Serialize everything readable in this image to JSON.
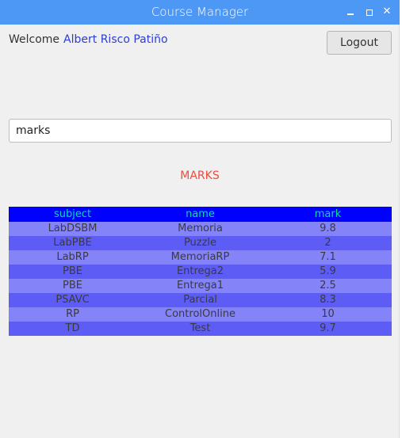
{
  "window": {
    "title": "Course Manager",
    "titlebar_color": "#4d98f5"
  },
  "header": {
    "welcome_label": "Welcome",
    "user_name": "Albert Risco Patiño",
    "logout_label": "Logout"
  },
  "search": {
    "value": "marks"
  },
  "section": {
    "title": "MARKS",
    "title_color": "#f04a3a"
  },
  "table": {
    "header_color": "#0000ff",
    "header_text_color": "#00e0a0",
    "row_color_light": "#8484f8",
    "row_color_dark": "#5d5df6",
    "columns": [
      "subject",
      "name",
      "mark"
    ],
    "rows": [
      [
        "LabDSBM",
        "Memoria",
        "9.8"
      ],
      [
        "LabPBE",
        "Puzzle",
        "2"
      ],
      [
        "LabRP",
        "MemoriaRP",
        "7.1"
      ],
      [
        "PBE",
        "Entrega2",
        "5.9"
      ],
      [
        "PBE",
        "Entrega1",
        "2.5"
      ],
      [
        "PSAVC",
        "Parcial",
        "8.3"
      ],
      [
        "RP",
        "ControlOnline",
        "10"
      ],
      [
        "TD",
        "Test",
        "9.7"
      ]
    ]
  }
}
